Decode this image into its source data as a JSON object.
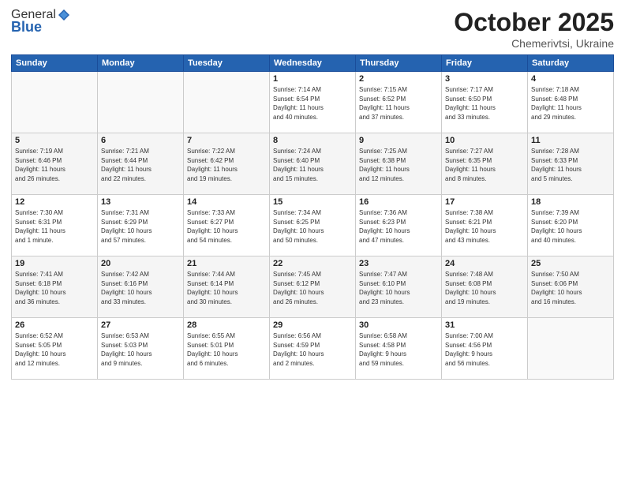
{
  "logo": {
    "general": "General",
    "blue": "Blue"
  },
  "title": "October 2025",
  "subtitle": "Chemerivtsi, Ukraine",
  "weekdays": [
    "Sunday",
    "Monday",
    "Tuesday",
    "Wednesday",
    "Thursday",
    "Friday",
    "Saturday"
  ],
  "rows": [
    [
      {
        "day": "",
        "info": ""
      },
      {
        "day": "",
        "info": ""
      },
      {
        "day": "",
        "info": ""
      },
      {
        "day": "1",
        "info": "Sunrise: 7:14 AM\nSunset: 6:54 PM\nDaylight: 11 hours\nand 40 minutes."
      },
      {
        "day": "2",
        "info": "Sunrise: 7:15 AM\nSunset: 6:52 PM\nDaylight: 11 hours\nand 37 minutes."
      },
      {
        "day": "3",
        "info": "Sunrise: 7:17 AM\nSunset: 6:50 PM\nDaylight: 11 hours\nand 33 minutes."
      },
      {
        "day": "4",
        "info": "Sunrise: 7:18 AM\nSunset: 6:48 PM\nDaylight: 11 hours\nand 29 minutes."
      }
    ],
    [
      {
        "day": "5",
        "info": "Sunrise: 7:19 AM\nSunset: 6:46 PM\nDaylight: 11 hours\nand 26 minutes."
      },
      {
        "day": "6",
        "info": "Sunrise: 7:21 AM\nSunset: 6:44 PM\nDaylight: 11 hours\nand 22 minutes."
      },
      {
        "day": "7",
        "info": "Sunrise: 7:22 AM\nSunset: 6:42 PM\nDaylight: 11 hours\nand 19 minutes."
      },
      {
        "day": "8",
        "info": "Sunrise: 7:24 AM\nSunset: 6:40 PM\nDaylight: 11 hours\nand 15 minutes."
      },
      {
        "day": "9",
        "info": "Sunrise: 7:25 AM\nSunset: 6:38 PM\nDaylight: 11 hours\nand 12 minutes."
      },
      {
        "day": "10",
        "info": "Sunrise: 7:27 AM\nSunset: 6:35 PM\nDaylight: 11 hours\nand 8 minutes."
      },
      {
        "day": "11",
        "info": "Sunrise: 7:28 AM\nSunset: 6:33 PM\nDaylight: 11 hours\nand 5 minutes."
      }
    ],
    [
      {
        "day": "12",
        "info": "Sunrise: 7:30 AM\nSunset: 6:31 PM\nDaylight: 11 hours\nand 1 minute."
      },
      {
        "day": "13",
        "info": "Sunrise: 7:31 AM\nSunset: 6:29 PM\nDaylight: 10 hours\nand 57 minutes."
      },
      {
        "day": "14",
        "info": "Sunrise: 7:33 AM\nSunset: 6:27 PM\nDaylight: 10 hours\nand 54 minutes."
      },
      {
        "day": "15",
        "info": "Sunrise: 7:34 AM\nSunset: 6:25 PM\nDaylight: 10 hours\nand 50 minutes."
      },
      {
        "day": "16",
        "info": "Sunrise: 7:36 AM\nSunset: 6:23 PM\nDaylight: 10 hours\nand 47 minutes."
      },
      {
        "day": "17",
        "info": "Sunrise: 7:38 AM\nSunset: 6:21 PM\nDaylight: 10 hours\nand 43 minutes."
      },
      {
        "day": "18",
        "info": "Sunrise: 7:39 AM\nSunset: 6:20 PM\nDaylight: 10 hours\nand 40 minutes."
      }
    ],
    [
      {
        "day": "19",
        "info": "Sunrise: 7:41 AM\nSunset: 6:18 PM\nDaylight: 10 hours\nand 36 minutes."
      },
      {
        "day": "20",
        "info": "Sunrise: 7:42 AM\nSunset: 6:16 PM\nDaylight: 10 hours\nand 33 minutes."
      },
      {
        "day": "21",
        "info": "Sunrise: 7:44 AM\nSunset: 6:14 PM\nDaylight: 10 hours\nand 30 minutes."
      },
      {
        "day": "22",
        "info": "Sunrise: 7:45 AM\nSunset: 6:12 PM\nDaylight: 10 hours\nand 26 minutes."
      },
      {
        "day": "23",
        "info": "Sunrise: 7:47 AM\nSunset: 6:10 PM\nDaylight: 10 hours\nand 23 minutes."
      },
      {
        "day": "24",
        "info": "Sunrise: 7:48 AM\nSunset: 6:08 PM\nDaylight: 10 hours\nand 19 minutes."
      },
      {
        "day": "25",
        "info": "Sunrise: 7:50 AM\nSunset: 6:06 PM\nDaylight: 10 hours\nand 16 minutes."
      }
    ],
    [
      {
        "day": "26",
        "info": "Sunrise: 6:52 AM\nSunset: 5:05 PM\nDaylight: 10 hours\nand 12 minutes."
      },
      {
        "day": "27",
        "info": "Sunrise: 6:53 AM\nSunset: 5:03 PM\nDaylight: 10 hours\nand 9 minutes."
      },
      {
        "day": "28",
        "info": "Sunrise: 6:55 AM\nSunset: 5:01 PM\nDaylight: 10 hours\nand 6 minutes."
      },
      {
        "day": "29",
        "info": "Sunrise: 6:56 AM\nSunset: 4:59 PM\nDaylight: 10 hours\nand 2 minutes."
      },
      {
        "day": "30",
        "info": "Sunrise: 6:58 AM\nSunset: 4:58 PM\nDaylight: 9 hours\nand 59 minutes."
      },
      {
        "day": "31",
        "info": "Sunrise: 7:00 AM\nSunset: 4:56 PM\nDaylight: 9 hours\nand 56 minutes."
      },
      {
        "day": "",
        "info": ""
      }
    ]
  ]
}
